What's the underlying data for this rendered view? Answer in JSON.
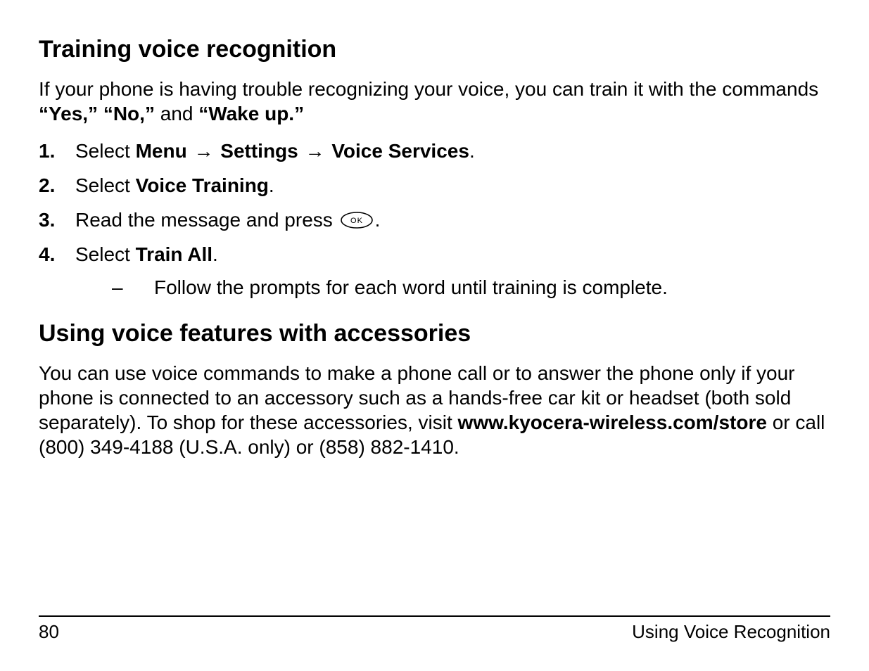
{
  "section1": {
    "heading": "Training voice recognition",
    "intro_pre": "If your phone is having trouble recognizing your voice, you can train it with the commands ",
    "intro_b1": "“Yes,” “No,”",
    "intro_mid": " and ",
    "intro_b2": "“Wake up.”",
    "steps": {
      "s1_num": "1.",
      "s1_select": "Select ",
      "s1_menu": "Menu",
      "s1_arrow": " → ",
      "s1_settings": "Settings",
      "s1_voice": "Voice Services",
      "s1_period": ".",
      "s2_num": "2.",
      "s2_select": "Select ",
      "s2_vt": "Voice Training",
      "s2_period": ".",
      "s3_num": "3.",
      "s3_pre": "Read the message and press ",
      "s3_period": ".",
      "s4_num": "4.",
      "s4_select": "Select ",
      "s4_ta": "Train All",
      "s4_period": ".",
      "s4_sub_dash": "–",
      "s4_sub_text": "Follow the prompts for each word until training is complete."
    }
  },
  "section2": {
    "heading": "Using voice features with accessories",
    "p_pre": "You can use voice commands to make a phone call or to answer the phone only if your phone is connected to an accessory such as a hands-free car kit or headset (both sold separately). To shop for these accessories, visit ",
    "p_url": "www.kyocera-wireless.com/store",
    "p_post": " or call (800) 349-4188 (U.S.A. only) or (858) 882-1410."
  },
  "footer": {
    "page": "80",
    "title": "Using Voice Recognition"
  },
  "icons": {
    "ok_label": "OK"
  }
}
